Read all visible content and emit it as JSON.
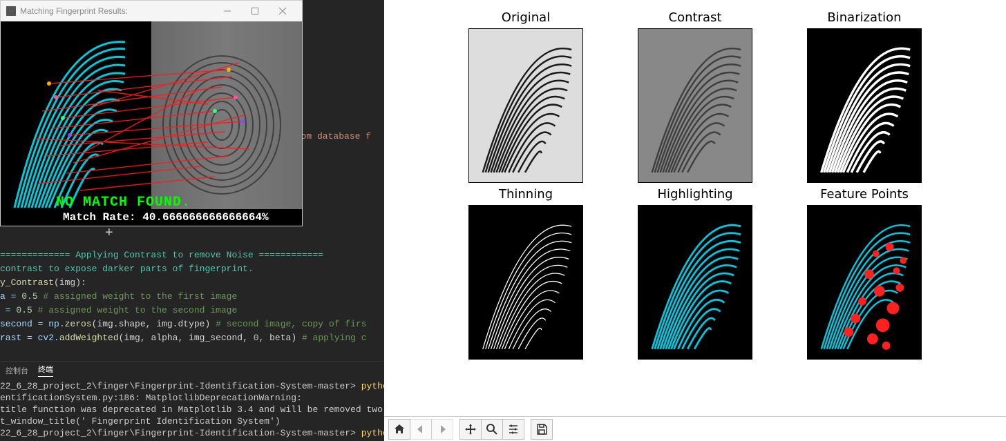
{
  "popup": {
    "title": "Matching Fingerprint Results:",
    "no_match_text": "NO MATCH FOUND.",
    "rate_label": "Match Rate: 40.666666666666664%"
  },
  "bg_text": "from database f",
  "code": {
    "sep": "============= Applying Contrast to remove Noise ============",
    "l1": "contrast to expose darker parts of fingerprint.",
    "l2a": "y_Contrast",
    "l2b": "(img):",
    "l3a": "a = ",
    "l3b": "0.5",
    "l3c": " # assigned weight to the first image",
    "l4a": " = ",
    "l4b": "0.5",
    "l4c": " # assigned weight to the second image",
    "l5a": "second = np.",
    "l5b": "zeros",
    "l5c": "(img.shape, img.dtype) ",
    "l5d": "# second image, copy of firs",
    "l6a": "rast = cv2.",
    "l6b": "addWeighted",
    "l6c": "(img, alpha, img_second, ",
    "l6d": "0",
    "l6e": ", beta) ",
    "l6f": "# applying c"
  },
  "tabs": {
    "console": "控制台",
    "terminal": "终端"
  },
  "terminal": {
    "l1a": "22_6_28_project_2\\finger\\Fingerprint-Identification-System-master> ",
    "l1b": "python",
    "l2": "entificationSystem.py:186: MatplotlibDeprecationWarning:",
    "l3": "title function was deprecated in Matplotlib 3.4 and will be removed two m",
    "l4": "t_window_title(' Fingerprint Identification System')",
    "l5a": "22_6_28_project_2\\finger\\Fingerprint-Identification-System-master> ",
    "l5b": "python"
  },
  "plots": {
    "t1": "Original",
    "t2": "Contrast",
    "t3": "Binarization",
    "t4": "Thinning",
    "t5": "Highlighting",
    "t6": "Feature Points"
  },
  "icons": {
    "home": "home-icon",
    "back": "back-icon",
    "forward": "forward-icon",
    "pan": "pan-icon",
    "zoom": "zoom-icon",
    "config": "config-icon",
    "save": "save-icon"
  }
}
